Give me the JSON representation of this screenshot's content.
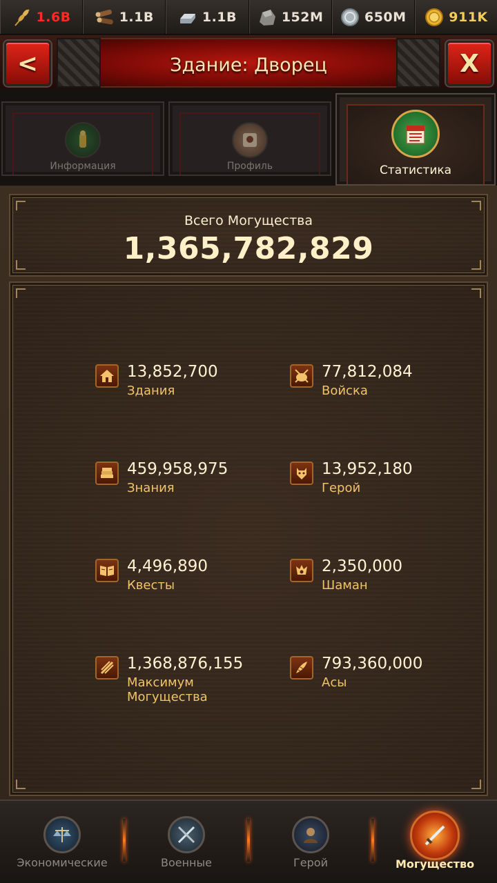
{
  "resources": [
    {
      "icon": "wheat-icon",
      "value": "1.6B",
      "color": "#ff2a22"
    },
    {
      "icon": "wood-logs-icon",
      "value": "1.1B",
      "color": "#e8e2d6"
    },
    {
      "icon": "iron-ingot-icon",
      "value": "1.1B",
      "color": "#e8e2d6"
    },
    {
      "icon": "stone-icon",
      "value": "152M",
      "color": "#e8e2d6"
    },
    {
      "icon": "silver-coin-icon",
      "value": "650M",
      "color": "#e8e2d6"
    },
    {
      "icon": "gold-coin-icon",
      "value": "911K",
      "color": "#f4cc5a"
    }
  ],
  "header": {
    "title": "Здание: Дворец",
    "back_label": "<",
    "close_label": "X"
  },
  "tabs": [
    {
      "label": "Информация",
      "icon": "info-tab-icon",
      "active": false
    },
    {
      "label": "Профиль",
      "icon": "profile-tab-icon",
      "active": false
    },
    {
      "label": "Статистика",
      "icon": "statistics-tab-icon",
      "active": true
    }
  ],
  "total": {
    "label": "Всего Могущества",
    "value": "1,365,782,829"
  },
  "stats": [
    {
      "icon": "buildings-icon",
      "value": "13,852,700",
      "label": "Здания"
    },
    {
      "icon": "troops-icon",
      "value": "77,812,084",
      "label": "Войска"
    },
    {
      "icon": "knowledge-icon",
      "value": "459,958,975",
      "label": "Знания"
    },
    {
      "icon": "hero-icon",
      "value": "13,952,180",
      "label": "Герой"
    },
    {
      "icon": "quests-icon",
      "value": "4,496,890",
      "label": "Квесты"
    },
    {
      "icon": "shaman-icon",
      "value": "2,350,000",
      "label": "Шаман"
    },
    {
      "icon": "max-power-icon",
      "value": "1,368,876,155",
      "label": "Максимум Могущества"
    },
    {
      "icon": "aces-icon",
      "value": "793,360,000",
      "label": "Асы"
    }
  ],
  "nav": [
    {
      "label": "Экономические",
      "icon": "economic-icon",
      "active": false
    },
    {
      "label": "Военные",
      "icon": "military-icon",
      "active": false
    },
    {
      "label": "Герой",
      "icon": "hero-nav-icon",
      "active": false
    },
    {
      "label": "Могущество",
      "icon": "power-icon",
      "active": true
    }
  ],
  "colors": {
    "accent_red": "#b7170f",
    "gold_text": "#f1c46a",
    "active_glow": "#e4511d"
  }
}
